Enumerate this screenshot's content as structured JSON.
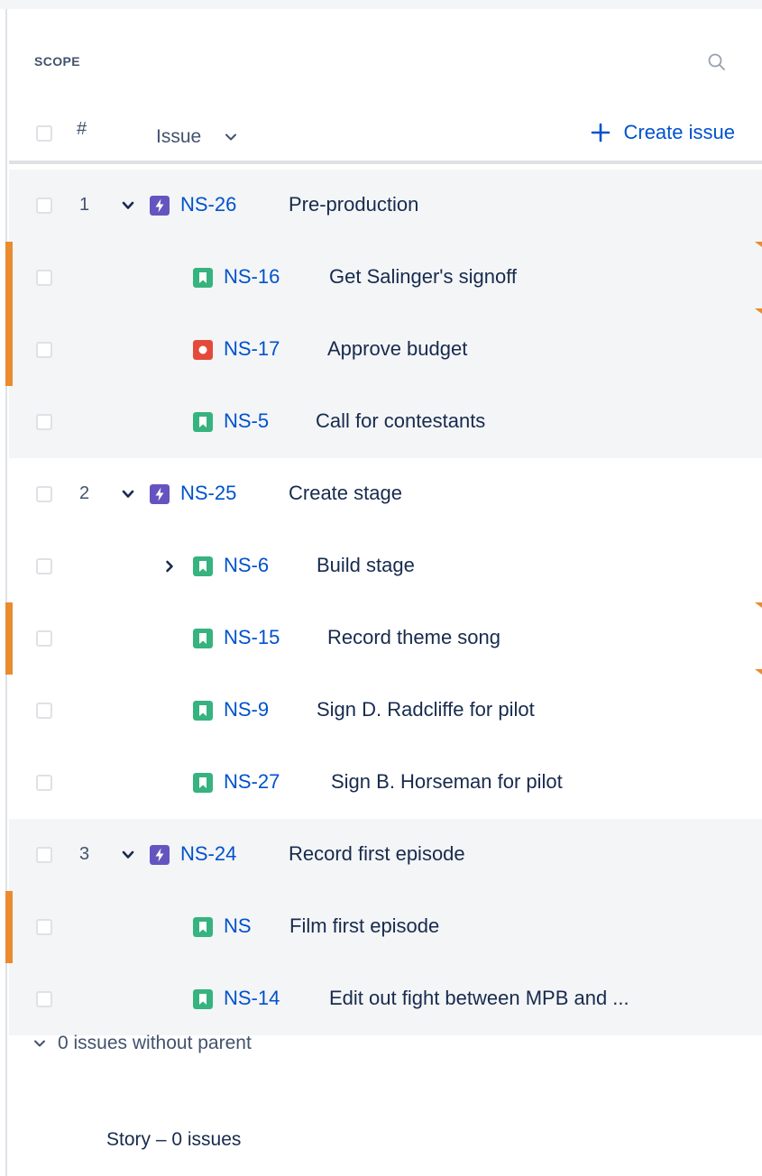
{
  "header": {
    "title": "SCOPE",
    "search_icon": "search-icon",
    "hash": "#",
    "issue_col": "Issue",
    "create_issue": "Create issue"
  },
  "colors": {
    "link": "#0052cc",
    "epic": "#6554c0",
    "story": "#36b37e",
    "bug": "#e5493a",
    "flag": "#e98b2f",
    "row_shade": "#f4f5f7"
  },
  "rows": [
    {
      "rank": "1",
      "key": "NS-26",
      "summary": "Pre-production",
      "type": "epic",
      "level": 0
    },
    {
      "rank": "",
      "key": "NS-16",
      "summary": "Get Salinger's signoff",
      "type": "story",
      "level": 1
    },
    {
      "rank": "",
      "key": "NS-17",
      "summary": "Approve budget",
      "type": "bug",
      "level": 1
    },
    {
      "rank": "",
      "key": "NS-5",
      "summary": "Call for contestants",
      "type": "story",
      "level": 1
    },
    {
      "rank": "2",
      "key": "NS-25",
      "summary": "Create stage",
      "type": "epic",
      "level": 0
    },
    {
      "rank": "",
      "key": "NS-6",
      "summary": "Build stage",
      "type": "story",
      "level": 1,
      "collapsed": true
    },
    {
      "rank": "",
      "key": "NS-15",
      "summary": "Record theme song",
      "type": "story",
      "level": 1
    },
    {
      "rank": "",
      "key": "NS-9",
      "summary": "Sign D. Radcliffe for pilot",
      "type": "story",
      "level": 1
    },
    {
      "rank": "",
      "key": "NS-27",
      "summary": "Sign B. Horseman for pilot",
      "type": "story",
      "level": 1
    },
    {
      "rank": "3",
      "key": "NS-24",
      "summary": "Record first episode",
      "type": "epic",
      "level": 0
    },
    {
      "rank": "",
      "key": "NS",
      "summary": "Film first episode",
      "type": "story",
      "level": 1
    },
    {
      "rank": "",
      "key": "NS-14",
      "summary": "Edit out fight between MPB and ...",
      "type": "story",
      "level": 1
    }
  ],
  "footer": {
    "no_parent": "0 issues without parent",
    "story_group": "Story – 0 issues"
  }
}
